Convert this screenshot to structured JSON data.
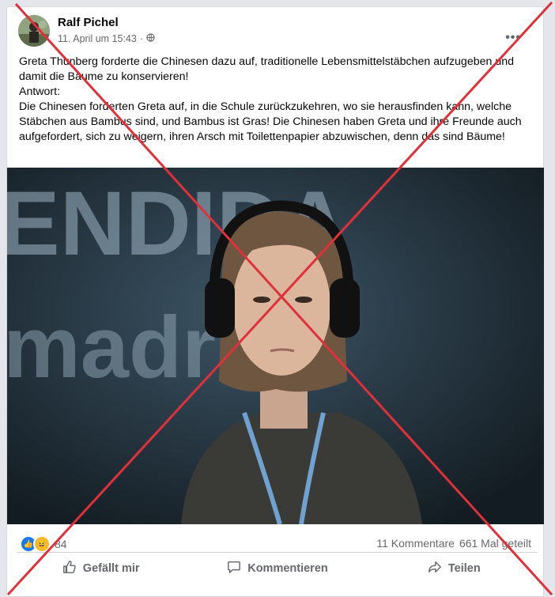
{
  "post": {
    "author": "Ralf Pichel",
    "timestamp": "11. April um 15:43",
    "separator": "·",
    "paragraphs": [
      "Greta Thunberg forderte die Chinesen dazu auf, traditionelle Lebensmittelstäbchen aufzugeben und damit die Bäume zu konservieren!",
      "Antwort:",
      "Die Chinesen forderten Greta auf, in die Schule zurückzukehren, wo sie herausfinden kann, welche Stäbchen aus Bambus sind, und Bambus ist Gras! Die Chinesen haben Greta und ihre Freunde auch aufgefordert, sich zu weigern, ihren Arsch mit Toilettenpapier abzuwischen, denn das sind Bäume!"
    ],
    "photo": {
      "backdrop_text_1": "ENDIDA",
      "backdrop_text_2": "madrid"
    }
  },
  "stats": {
    "reaction_count": "84",
    "comments": "11 Kommentare",
    "shares": "661 Mal geteilt"
  },
  "actions": {
    "like": "Gefällt mir",
    "comment": "Kommentieren",
    "share": "Teilen"
  },
  "colors": {
    "cross": "#e0303a",
    "like_blue": "#1877f2",
    "haha_yellow": "#f7b928"
  }
}
